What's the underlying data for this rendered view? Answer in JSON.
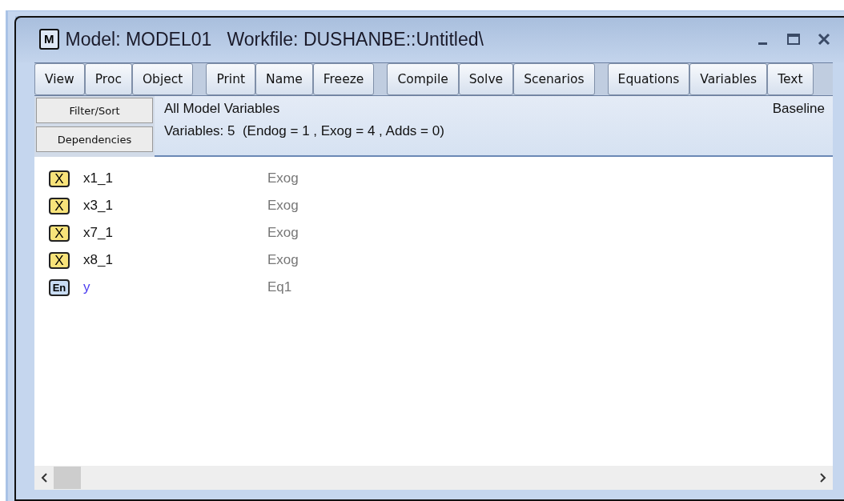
{
  "window": {
    "icon_letter": "M",
    "title": "Model: MODEL01   Workfile: DUSHANBE::Untitled\\"
  },
  "toolbar": [
    [
      "View",
      "Proc",
      "Object"
    ],
    [
      "Print",
      "Name",
      "Freeze"
    ],
    [
      "Compile",
      "Solve",
      "Scenarios"
    ],
    [
      "Equations",
      "Variables",
      "Text"
    ]
  ],
  "side_buttons": [
    "Filter/Sort",
    "Dependencies"
  ],
  "header": {
    "title": "All Model Variables",
    "summary": "Variables: 5  (Endog = 1 , Exog = 4 , Adds = 0)",
    "scenario": "Baseline"
  },
  "variables": [
    {
      "kind": "exog",
      "badge": "X",
      "name": "x1_1",
      "source": "Exog"
    },
    {
      "kind": "exog",
      "badge": "X",
      "name": "x3_1",
      "source": "Exog"
    },
    {
      "kind": "exog",
      "badge": "X",
      "name": "x7_1",
      "source": "Exog"
    },
    {
      "kind": "exog",
      "badge": "X",
      "name": "x8_1",
      "source": "Exog"
    },
    {
      "kind": "endog",
      "badge": "En",
      "name": "y",
      "source": "Eq1"
    }
  ]
}
